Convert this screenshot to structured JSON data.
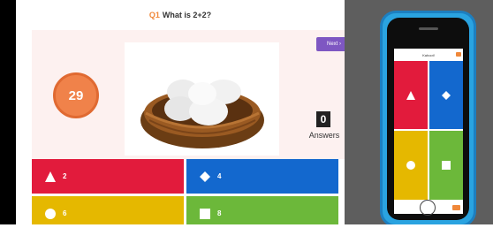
{
  "question": {
    "number": "Q1",
    "text": "What is 2+2?"
  },
  "timer": {
    "value": "29"
  },
  "next_button": {
    "label": "Next ›"
  },
  "answers_count": {
    "value": "0",
    "label": "Answers"
  },
  "answers": [
    {
      "shape": "triangle-icon",
      "label": "2"
    },
    {
      "shape": "diamond-icon",
      "label": "4"
    },
    {
      "shape": "circle-icon",
      "label": "6"
    },
    {
      "shape": "square-icon",
      "label": "8"
    }
  ],
  "phone": {
    "header": "Kahoot!",
    "tiles": [
      {
        "shape": "triangle-icon"
      },
      {
        "shape": "diamond-icon"
      },
      {
        "shape": "circle-icon"
      },
      {
        "shape": "square-icon"
      }
    ]
  },
  "colors": {
    "red": "#e21b3c",
    "blue": "#1368ce",
    "yellow": "#e5b800",
    "green": "#6cb83a",
    "timer": "#f0824a",
    "next_button": "#7e57c2",
    "phone_frame": "#2aa3e0"
  }
}
